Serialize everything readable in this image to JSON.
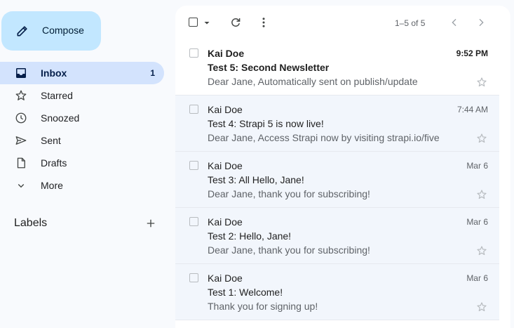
{
  "compose": {
    "label": "Compose",
    "icon": "pencil-icon"
  },
  "nav": [
    {
      "key": "inbox",
      "label": "Inbox",
      "count": "1",
      "icon": "inbox-icon",
      "active": true
    },
    {
      "key": "starred",
      "label": "Starred",
      "icon": "star-icon"
    },
    {
      "key": "snoozed",
      "label": "Snoozed",
      "icon": "clock-icon"
    },
    {
      "key": "sent",
      "label": "Sent",
      "icon": "send-icon"
    },
    {
      "key": "drafts",
      "label": "Drafts",
      "icon": "draft-icon"
    },
    {
      "key": "more",
      "label": "More",
      "icon": "chevron-down-icon"
    }
  ],
  "labels": {
    "title": "Labels",
    "add_icon": "plus-icon"
  },
  "toolbar": {
    "pager": "1–5 of 5"
  },
  "messages": [
    {
      "sender": "Kai Doe",
      "subject": "Test 5: Second Newsletter",
      "snippet": "Dear Jane, Automatically sent on publish/update",
      "date": "9:52 PM",
      "unread": true
    },
    {
      "sender": "Kai Doe",
      "subject": "Test 4: Strapi 5 is now live!",
      "snippet": "Dear Jane, Access Strapi now by visiting strapi.io/five",
      "date": "7:44 AM",
      "unread": false
    },
    {
      "sender": "Kai Doe",
      "subject": "Test 3: All Hello, Jane!",
      "snippet": "Dear Jane, thank you for subscribing!",
      "date": "Mar 6",
      "unread": false
    },
    {
      "sender": "Kai Doe",
      "subject": "Test 2: Hello, Jane!",
      "snippet": "Dear Jane, thank you for subscribing!",
      "date": "Mar 6",
      "unread": false
    },
    {
      "sender": "Kai Doe",
      "subject": "Test 1: Welcome!",
      "snippet": "Thank you for signing up!",
      "date": "Mar 6",
      "unread": false
    }
  ],
  "colors": {
    "compose_bg": "#c2e7ff",
    "active_nav_bg": "#d3e3fd",
    "read_row_bg": "#f2f6fc",
    "page_bg": "#f8fafd"
  }
}
